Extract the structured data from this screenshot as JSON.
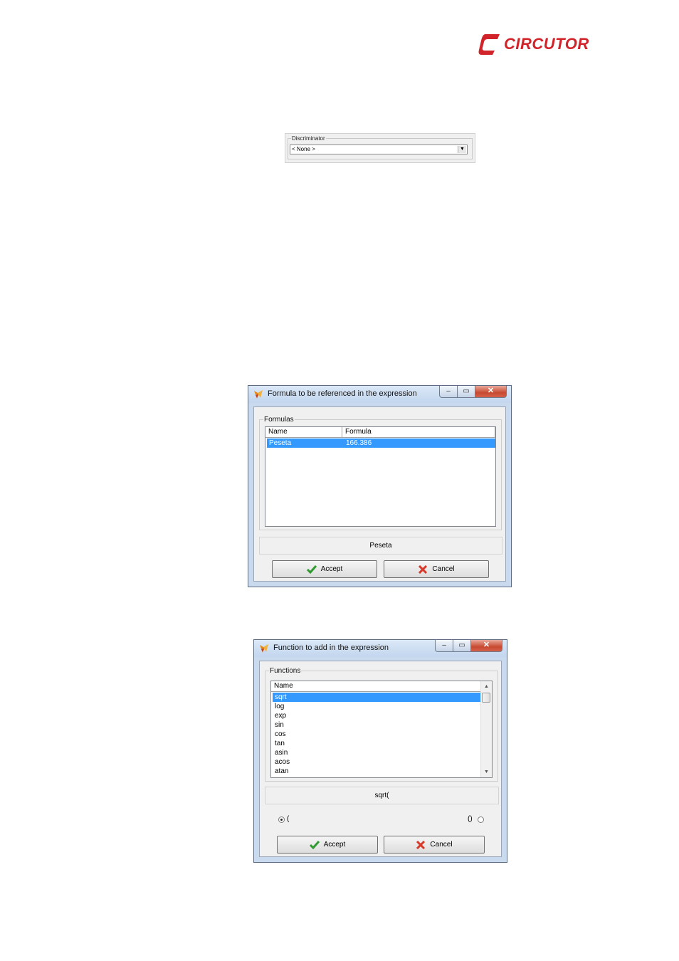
{
  "logo": {
    "text": "CIRCUTOR"
  },
  "discriminator": {
    "label": "Discriminator",
    "value": "< None >"
  },
  "formula_dialog": {
    "title": "Formula to be referenced in the expression",
    "group_label": "Formulas",
    "columns": [
      "Name",
      "Formula"
    ],
    "rows": [
      {
        "name": "Peseta",
        "formula": "166.386",
        "selected": true
      }
    ],
    "preview": "Peseta",
    "accept_label": "Accept",
    "cancel_label": "Cancel"
  },
  "function_dialog": {
    "title": "Function to add in the expression",
    "group_label": "Functions",
    "column": "Name",
    "items": [
      "sqrt",
      "log",
      "exp",
      "sin",
      "cos",
      "tan",
      "asin",
      "acos",
      "atan"
    ],
    "selected_index": 0,
    "preview": "sqrt(",
    "radio_left_label": "(",
    "radio_right_label": "()",
    "accept_label": "Accept",
    "cancel_label": "Cancel"
  },
  "colors": {
    "accent": "#3399ff",
    "brand": "#d1232a",
    "close_button": "#c74a30"
  }
}
